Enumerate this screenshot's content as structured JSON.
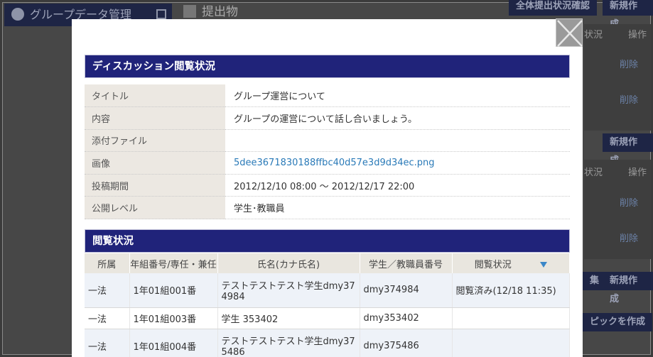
{
  "background": {
    "sidebar_title": "グループデータ管理",
    "page_title": "提出物",
    "top_button_1": "全体提出状況確認",
    "top_button_2": "新規作成",
    "col_status": "状況",
    "col_ops": "操作",
    "delete_1": "削除",
    "delete_2": "削除",
    "new_button_2": "新規作成",
    "col_status_2": "状況",
    "col_ops_2": "操作",
    "delete_3": "削除",
    "delete_4": "削除",
    "button_collect": "集",
    "new_button_3": "新規作成",
    "topic_button": "ピックを作成"
  },
  "modal": {
    "discussion_header": "ディスカッション閲覧状況",
    "info": [
      {
        "label": "タイトル",
        "value": "グループ運営について"
      },
      {
        "label": "内容",
        "value": "グループの運営について話し合いましょう。"
      },
      {
        "label": "添付ファイル",
        "value": ""
      },
      {
        "label": "画像",
        "value": "5dee3671830188ffbc40d57e3d9d34ec.png"
      },
      {
        "label": "投稿期間",
        "value": "2012/12/10 08:00 〜 2012/12/17 22:00"
      },
      {
        "label": "公開レベル",
        "value": "学生･教職員"
      }
    ],
    "view_header": "閲覧状況",
    "columns": [
      "所属",
      "年組番号/専任・兼任",
      "氏名(カナ氏名)",
      "学生／教職員番号",
      "閲覧状況"
    ],
    "rows": [
      {
        "dept": "一法",
        "class": "1年01組001番",
        "name": "テストテストテスト学生dmy374984",
        "id": "dmy374984",
        "status": "閲覧済み(12/18 11:35)"
      },
      {
        "dept": "一法",
        "class": "1年01組003番",
        "name": "学生 353402",
        "id": "dmy353402",
        "status": ""
      },
      {
        "dept": "一法",
        "class": "1年01組004番",
        "name": "テストテストテスト学生dmy375486",
        "id": "dmy375486",
        "status": ""
      }
    ]
  }
}
